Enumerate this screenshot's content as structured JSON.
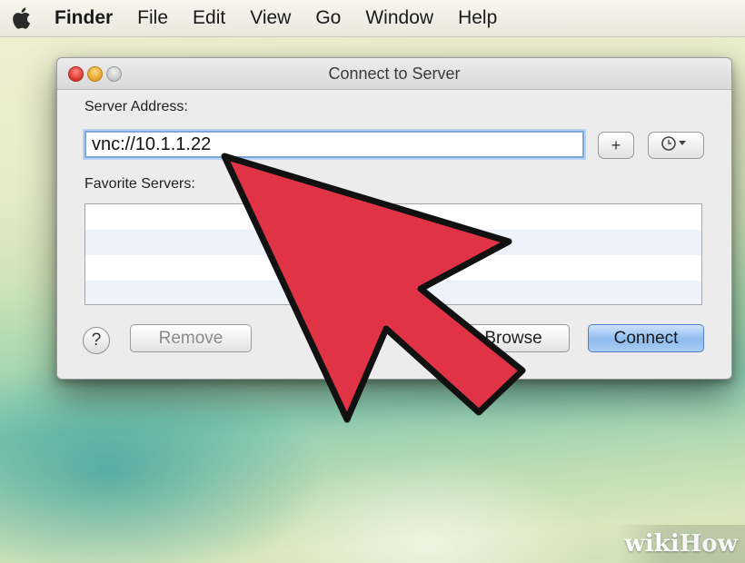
{
  "menubar": {
    "apple_icon": "apple-logo-icon",
    "items": [
      {
        "label": "Finder",
        "bold": true
      },
      {
        "label": "File"
      },
      {
        "label": "Edit"
      },
      {
        "label": "View"
      },
      {
        "label": "Go"
      },
      {
        "label": "Window"
      },
      {
        "label": "Help"
      }
    ]
  },
  "dialog": {
    "title": "Connect to Server",
    "server_address_label": "Server Address:",
    "server_address_value": "vnc://10.1.1.22",
    "add_button": "+",
    "recent_icon": "clock-icon",
    "favorites_label": "Favorite Servers:",
    "help_button": "?",
    "remove_button": "Remove",
    "browse_button": "Browse",
    "connect_button": "Connect"
  },
  "overlay": {
    "arrow_icon": "big-red-arrow-icon",
    "arrow_color": "#e03446"
  },
  "watermark": {
    "part1": "wiki",
    "part2": "How"
  },
  "colors": {
    "default_button": "#8fbbee",
    "focus_ring": "#7fa7dc"
  }
}
